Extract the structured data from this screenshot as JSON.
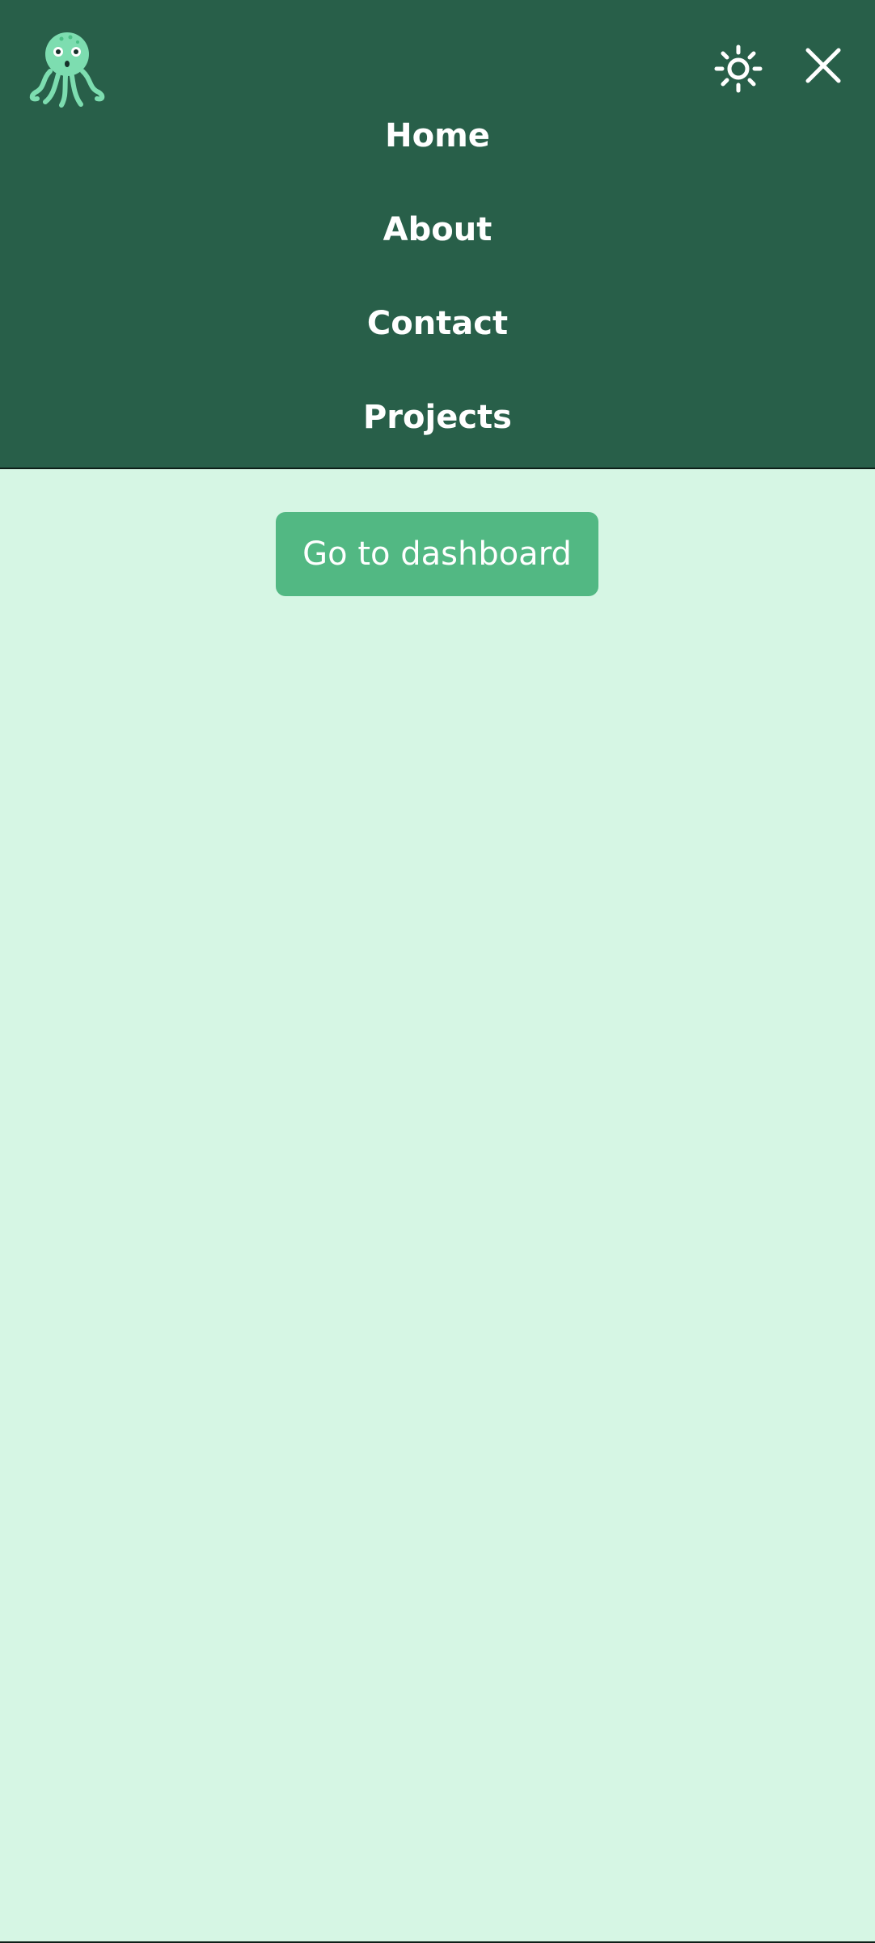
{
  "header": {
    "logo_icon": "octopus-icon",
    "theme_toggle_icon": "sun-icon",
    "close_icon": "close-icon",
    "background_color": "#285f49"
  },
  "nav": {
    "items": [
      {
        "label": "Home"
      },
      {
        "label": "About"
      },
      {
        "label": "Contact"
      },
      {
        "label": "Projects"
      }
    ]
  },
  "main": {
    "dashboard_button_label": "Go to dashboard",
    "button_color": "#52b883",
    "background_color": "#d6f6e4"
  }
}
